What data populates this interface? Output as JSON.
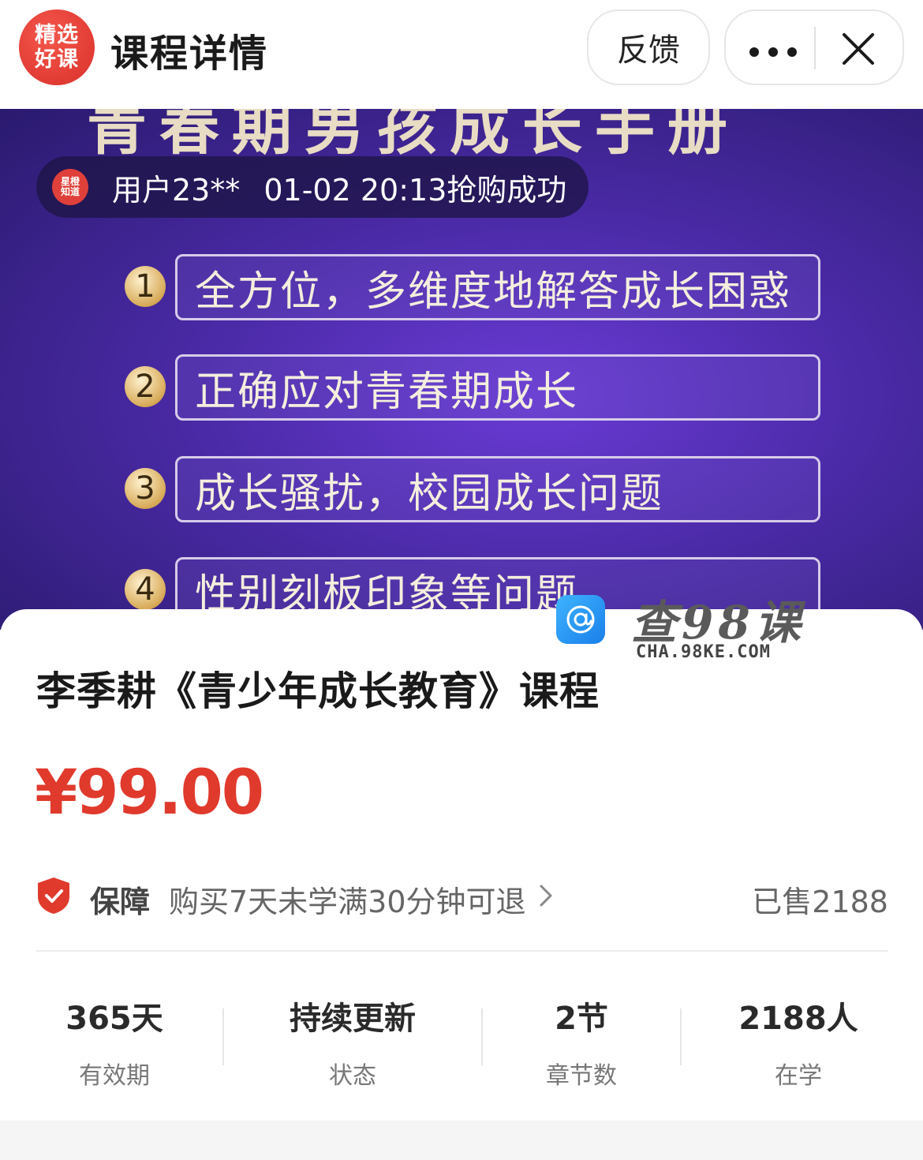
{
  "header": {
    "logo_text": "精选好课",
    "title": "课程详情",
    "feedback_label": "反馈",
    "more_icon": "more-dots-icon",
    "close_icon": "close-icon"
  },
  "banner": {
    "heading": "青春期男孩成长手册",
    "ticker": {
      "avatar_text": "星橙知道",
      "user": "用户23**",
      "time_text": "01-02 20:13抢购成功"
    },
    "features": [
      {
        "num": "1",
        "text": "全方位，多维度地解答成长困惑"
      },
      {
        "num": "2",
        "text": "正确应对青春期成长"
      },
      {
        "num": "3",
        "text": "成长骚扰，校园成长问题"
      },
      {
        "num": "4",
        "text": "性别刻板印象等问题"
      }
    ]
  },
  "watermark": {
    "title": "查98课",
    "subtitle": "CHA.98KE.COM"
  },
  "course": {
    "title": "李季耕《青少年成长教育》课程",
    "price": "¥99.00",
    "guarantee_label": "保障",
    "guarantee_text": "购买7天未学满30分钟可退",
    "sold": "已售2188"
  },
  "stats": [
    {
      "value": "365天",
      "label": "有效期"
    },
    {
      "value": "持续更新",
      "label": "状态"
    },
    {
      "value": "2节",
      "label": "章节数"
    },
    {
      "value": "2188人",
      "label": "在学"
    }
  ],
  "colors": {
    "accent_red": "#e03a2d",
    "banner_purple": "#4a2aa6",
    "watermark_blue": "#1a7fea"
  }
}
